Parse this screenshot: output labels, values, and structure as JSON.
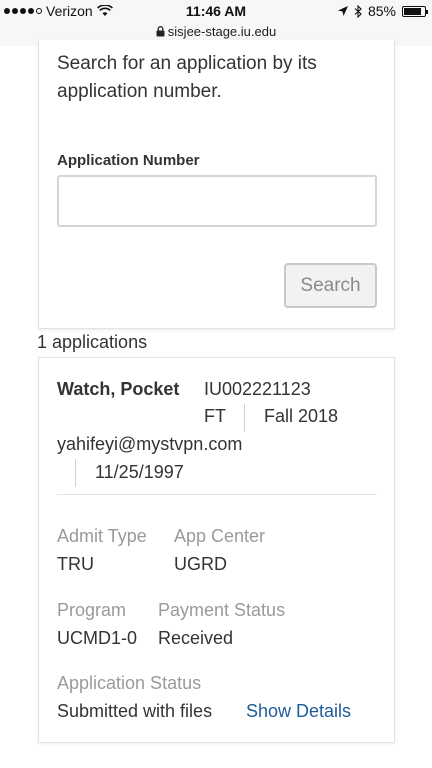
{
  "status_bar": {
    "carrier": "Verizon",
    "time": "11:46 AM",
    "battery": "85%",
    "battery_level": 0.85,
    "url": "sisjee-stage.iu.edu"
  },
  "search_panel": {
    "intro": "Search for an application by its application number.",
    "field_label": "Application Number",
    "field_value": "",
    "button_label": "Search"
  },
  "results": {
    "count_text": "1 applications",
    "items": [
      {
        "name": "Watch, Pocket",
        "app_number": "IU002221123",
        "enrollment": "FT",
        "term": "Fall 2018",
        "email": "yahifeyi@mystvpn.com",
        "dob": "11/25/1997",
        "admit_type_label": "Admit Type",
        "admit_type": "TRU",
        "app_center_label": "App Center",
        "app_center": "UGRD",
        "program_label": "Program",
        "program": "UCMD1-0",
        "payment_status_label": "Payment Status",
        "payment_status": "Received",
        "application_status_label": "Application Status",
        "application_status": "Submitted with files",
        "details_link": "Show Details"
      }
    ]
  },
  "colors": {
    "link": "#1f5c99",
    "label_gray": "#9a9a9a",
    "text": "#333333"
  }
}
